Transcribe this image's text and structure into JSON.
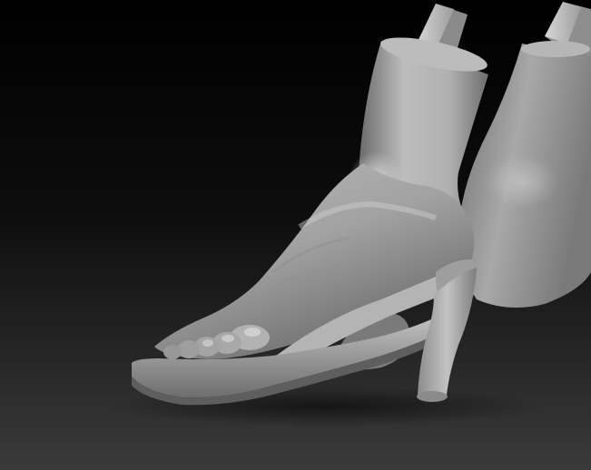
{
  "scene": {
    "subject": "sculpted-feet-in-high-heel-sandal",
    "colors": {
      "background_top": "#000000",
      "background_bottom": "#3a3a3a",
      "clay_light": "#c8c8c8",
      "clay_mid": "#9a9a9a",
      "clay_dark": "#4a4a4a"
    }
  }
}
